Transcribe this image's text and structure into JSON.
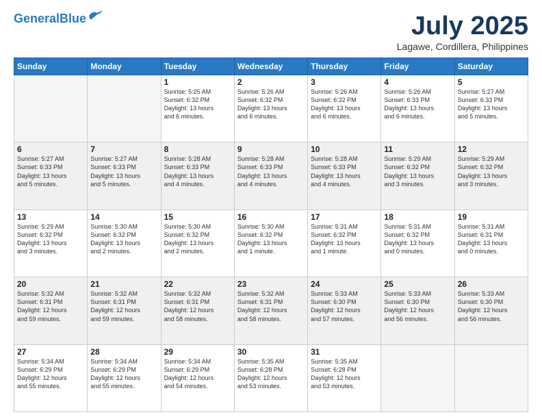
{
  "header": {
    "logo_line1": "General",
    "logo_line2": "Blue",
    "month": "July 2025",
    "location": "Lagawe, Cordillera, Philippines"
  },
  "days_of_week": [
    "Sunday",
    "Monday",
    "Tuesday",
    "Wednesday",
    "Thursday",
    "Friday",
    "Saturday"
  ],
  "weeks": [
    [
      {
        "day": "",
        "text": ""
      },
      {
        "day": "",
        "text": ""
      },
      {
        "day": "1",
        "text": "Sunrise: 5:25 AM\nSunset: 6:32 PM\nDaylight: 13 hours\nand 6 minutes."
      },
      {
        "day": "2",
        "text": "Sunrise: 5:26 AM\nSunset: 6:32 PM\nDaylight: 13 hours\nand 6 minutes."
      },
      {
        "day": "3",
        "text": "Sunrise: 5:26 AM\nSunset: 6:32 PM\nDaylight: 13 hours\nand 6 minutes."
      },
      {
        "day": "4",
        "text": "Sunrise: 5:26 AM\nSunset: 6:33 PM\nDaylight: 13 hours\nand 6 minutes."
      },
      {
        "day": "5",
        "text": "Sunrise: 5:27 AM\nSunset: 6:33 PM\nDaylight: 13 hours\nand 5 minutes."
      }
    ],
    [
      {
        "day": "6",
        "text": "Sunrise: 5:27 AM\nSunset: 6:33 PM\nDaylight: 13 hours\nand 5 minutes."
      },
      {
        "day": "7",
        "text": "Sunrise: 5:27 AM\nSunset: 6:33 PM\nDaylight: 13 hours\nand 5 minutes."
      },
      {
        "day": "8",
        "text": "Sunrise: 5:28 AM\nSunset: 6:33 PM\nDaylight: 13 hours\nand 4 minutes."
      },
      {
        "day": "9",
        "text": "Sunrise: 5:28 AM\nSunset: 6:33 PM\nDaylight: 13 hours\nand 4 minutes."
      },
      {
        "day": "10",
        "text": "Sunrise: 5:28 AM\nSunset: 6:33 PM\nDaylight: 13 hours\nand 4 minutes."
      },
      {
        "day": "11",
        "text": "Sunrise: 5:29 AM\nSunset: 6:32 PM\nDaylight: 13 hours\nand 3 minutes."
      },
      {
        "day": "12",
        "text": "Sunrise: 5:29 AM\nSunset: 6:32 PM\nDaylight: 13 hours\nand 3 minutes."
      }
    ],
    [
      {
        "day": "13",
        "text": "Sunrise: 5:29 AM\nSunset: 6:32 PM\nDaylight: 13 hours\nand 3 minutes."
      },
      {
        "day": "14",
        "text": "Sunrise: 5:30 AM\nSunset: 6:32 PM\nDaylight: 13 hours\nand 2 minutes."
      },
      {
        "day": "15",
        "text": "Sunrise: 5:30 AM\nSunset: 6:32 PM\nDaylight: 13 hours\nand 2 minutes."
      },
      {
        "day": "16",
        "text": "Sunrise: 5:30 AM\nSunset: 6:32 PM\nDaylight: 13 hours\nand 1 minute."
      },
      {
        "day": "17",
        "text": "Sunrise: 5:31 AM\nSunset: 6:32 PM\nDaylight: 13 hours\nand 1 minute."
      },
      {
        "day": "18",
        "text": "Sunrise: 5:31 AM\nSunset: 6:32 PM\nDaylight: 13 hours\nand 0 minutes."
      },
      {
        "day": "19",
        "text": "Sunrise: 5:31 AM\nSunset: 6:31 PM\nDaylight: 13 hours\nand 0 minutes."
      }
    ],
    [
      {
        "day": "20",
        "text": "Sunrise: 5:32 AM\nSunset: 6:31 PM\nDaylight: 12 hours\nand 59 minutes."
      },
      {
        "day": "21",
        "text": "Sunrise: 5:32 AM\nSunset: 6:31 PM\nDaylight: 12 hours\nand 59 minutes."
      },
      {
        "day": "22",
        "text": "Sunrise: 5:32 AM\nSunset: 6:31 PM\nDaylight: 12 hours\nand 58 minutes."
      },
      {
        "day": "23",
        "text": "Sunrise: 5:32 AM\nSunset: 6:31 PM\nDaylight: 12 hours\nand 58 minutes."
      },
      {
        "day": "24",
        "text": "Sunrise: 5:33 AM\nSunset: 6:30 PM\nDaylight: 12 hours\nand 57 minutes."
      },
      {
        "day": "25",
        "text": "Sunrise: 5:33 AM\nSunset: 6:30 PM\nDaylight: 12 hours\nand 56 minutes."
      },
      {
        "day": "26",
        "text": "Sunrise: 5:33 AM\nSunset: 6:30 PM\nDaylight: 12 hours\nand 56 minutes."
      }
    ],
    [
      {
        "day": "27",
        "text": "Sunrise: 5:34 AM\nSunset: 6:29 PM\nDaylight: 12 hours\nand 55 minutes."
      },
      {
        "day": "28",
        "text": "Sunrise: 5:34 AM\nSunset: 6:29 PM\nDaylight: 12 hours\nand 55 minutes."
      },
      {
        "day": "29",
        "text": "Sunrise: 5:34 AM\nSunset: 6:29 PM\nDaylight: 12 hours\nand 54 minutes."
      },
      {
        "day": "30",
        "text": "Sunrise: 5:35 AM\nSunset: 6:28 PM\nDaylight: 12 hours\nand 53 minutes."
      },
      {
        "day": "31",
        "text": "Sunrise: 5:35 AM\nSunset: 6:28 PM\nDaylight: 12 hours\nand 53 minutes."
      },
      {
        "day": "",
        "text": ""
      },
      {
        "day": "",
        "text": ""
      }
    ]
  ]
}
